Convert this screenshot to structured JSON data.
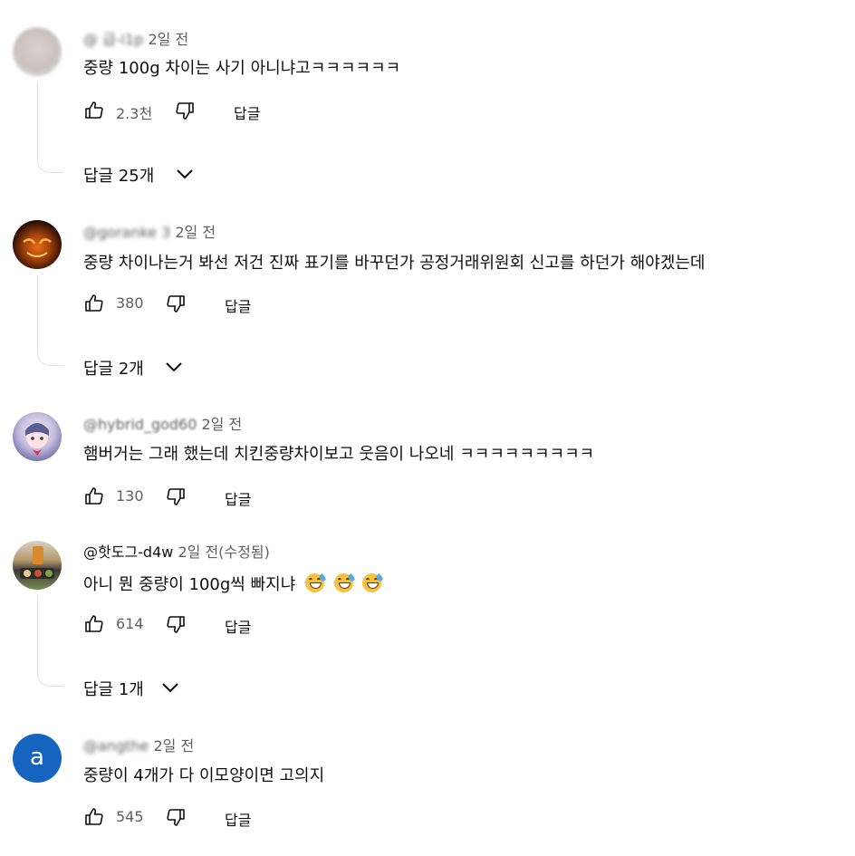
{
  "comments": [
    {
      "handle": "@ 급-i1p",
      "time": "2일 전",
      "edited": "",
      "text": "중량 100g 차이는 사기 아니냐고ㅋㅋㅋㅋㅋㅋ",
      "likes": "2.3천",
      "reply_label": "답글",
      "replies_label": "답글 25개",
      "avatar": "blurred-gray"
    },
    {
      "handle": "@goranke 3",
      "time": "2일 전",
      "edited": "",
      "text": "중량 차이나는거 봐선 저건 진짜 표기를 바꾸던가 공정거래위원회 신고를 하던가 해야겠는데",
      "likes": "380",
      "reply_label": "답글",
      "replies_label": "답글 2개",
      "avatar": "dark-orange-eyes"
    },
    {
      "handle": "@hybrid_god60",
      "time": "2일 전",
      "edited": "",
      "text": "햄버거는 그래 했는데 치킨중량차이보고 웃음이 나오네 ㅋㅋㅋㅋㅋㅋㅋㅋㅋ",
      "likes": "130",
      "reply_label": "답글",
      "replies_label": "",
      "avatar": "anime-character"
    },
    {
      "handle": "@핫도그-d4w",
      "time": "2일 전",
      "edited": "(수정됨)",
      "text": "아니 뭔 중량이 100g씩 빠지냐",
      "emoji": [
        "grinning-sweat-emoji",
        "grinning-sweat-emoji",
        "grinning-sweat-emoji"
      ],
      "likes": "614",
      "reply_label": "답글",
      "replies_label": "답글 1개",
      "avatar": "food-photo"
    },
    {
      "handle": "@angthe",
      "time": "2일 전",
      "edited": "",
      "text": "중량이 4개가 다 이모양이면 고의지",
      "likes": "545",
      "reply_label": "답글",
      "replies_label": "",
      "avatar": "letter-a",
      "avatar_letter": "a",
      "avatar_color": "#1565c0"
    }
  ],
  "icons": {
    "like": "thumbs-up-icon",
    "dislike": "thumbs-down-icon",
    "expand": "chevron-down-icon"
  }
}
